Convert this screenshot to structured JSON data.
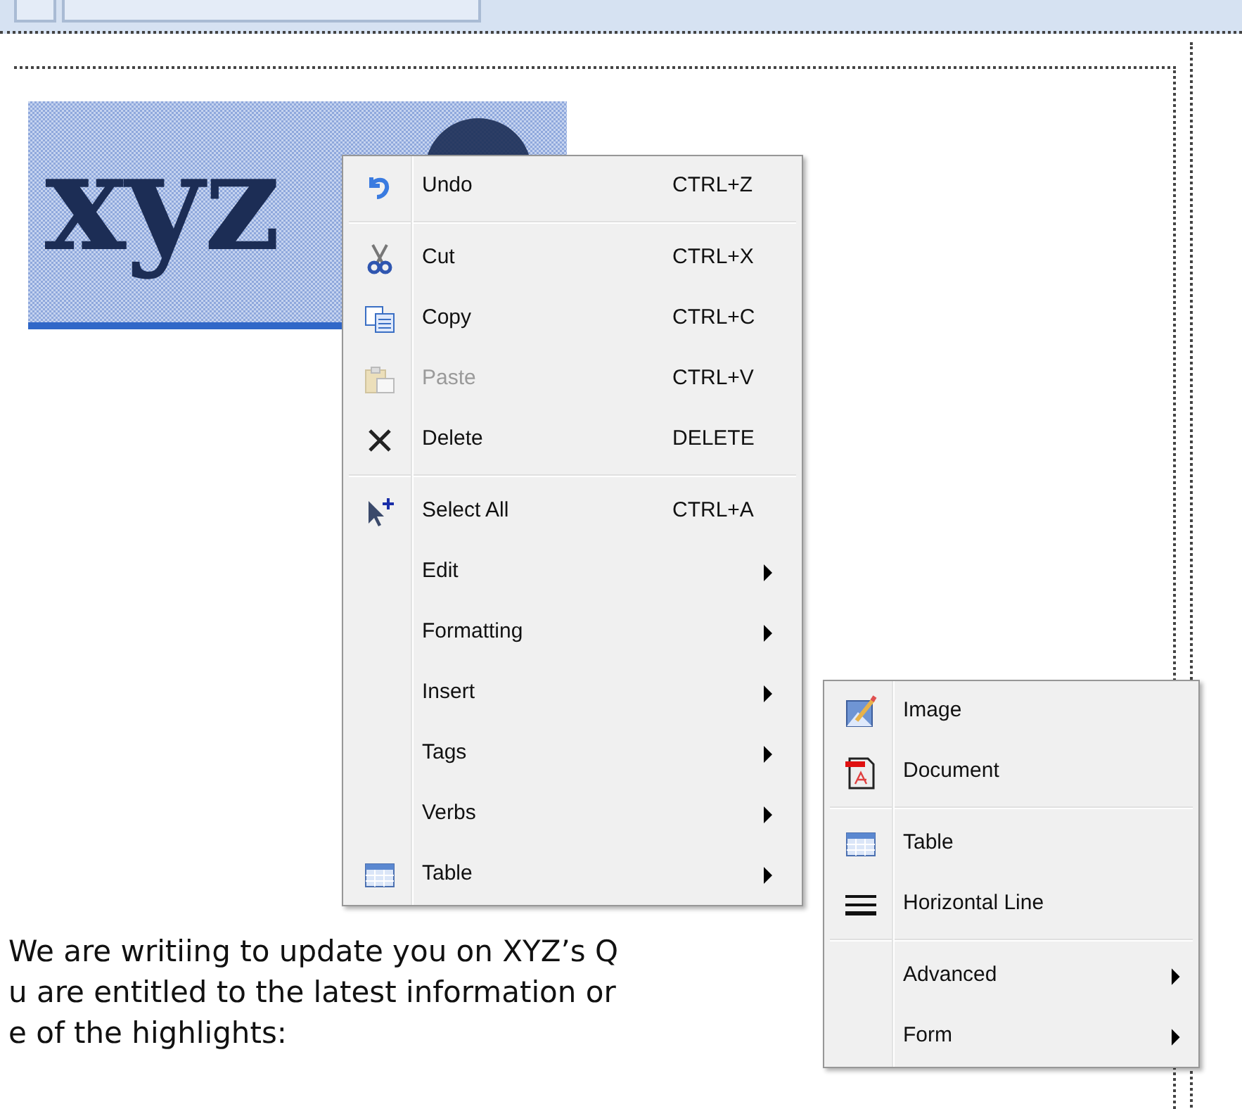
{
  "logo": {
    "text": "xyz",
    "selected": true
  },
  "body_text": [
    "We are writiing to update you on XYZ’s Q",
    "u are entitled to the latest information or",
    "e of the highlights:"
  ],
  "context_menu": {
    "groups": [
      [
        {
          "kind": "action",
          "label": "Undo",
          "shortcut": "CTRL+Z",
          "disabled": false
        }
      ],
      [
        {
          "kind": "action",
          "label": "Cut",
          "shortcut": "CTRL+X",
          "disabled": false
        },
        {
          "kind": "action",
          "label": "Copy",
          "shortcut": "CTRL+C",
          "disabled": false
        },
        {
          "kind": "action",
          "label": "Paste",
          "shortcut": "CTRL+V",
          "disabled": true
        },
        {
          "kind": "action",
          "label": "Delete",
          "shortcut": "DELETE",
          "disabled": false
        }
      ],
      [
        {
          "kind": "action",
          "label": "Select All",
          "shortcut": "CTRL+A",
          "disabled": false
        },
        {
          "kind": "submenu",
          "label": "Edit"
        },
        {
          "kind": "submenu",
          "label": "Formatting"
        },
        {
          "kind": "submenu",
          "label": "Insert"
        },
        {
          "kind": "submenu",
          "label": "Tags"
        },
        {
          "kind": "submenu",
          "label": "Verbs"
        },
        {
          "kind": "submenu",
          "label": "Table"
        }
      ]
    ]
  },
  "insert_submenu": {
    "groups": [
      [
        {
          "kind": "action",
          "label": "Image"
        },
        {
          "kind": "action",
          "label": "Document"
        }
      ],
      [
        {
          "kind": "action",
          "label": "Table"
        },
        {
          "kind": "action",
          "label": "Horizontal Line"
        }
      ],
      [
        {
          "kind": "submenu",
          "label": "Advanced"
        },
        {
          "kind": "submenu",
          "label": "Form"
        }
      ]
    ]
  }
}
